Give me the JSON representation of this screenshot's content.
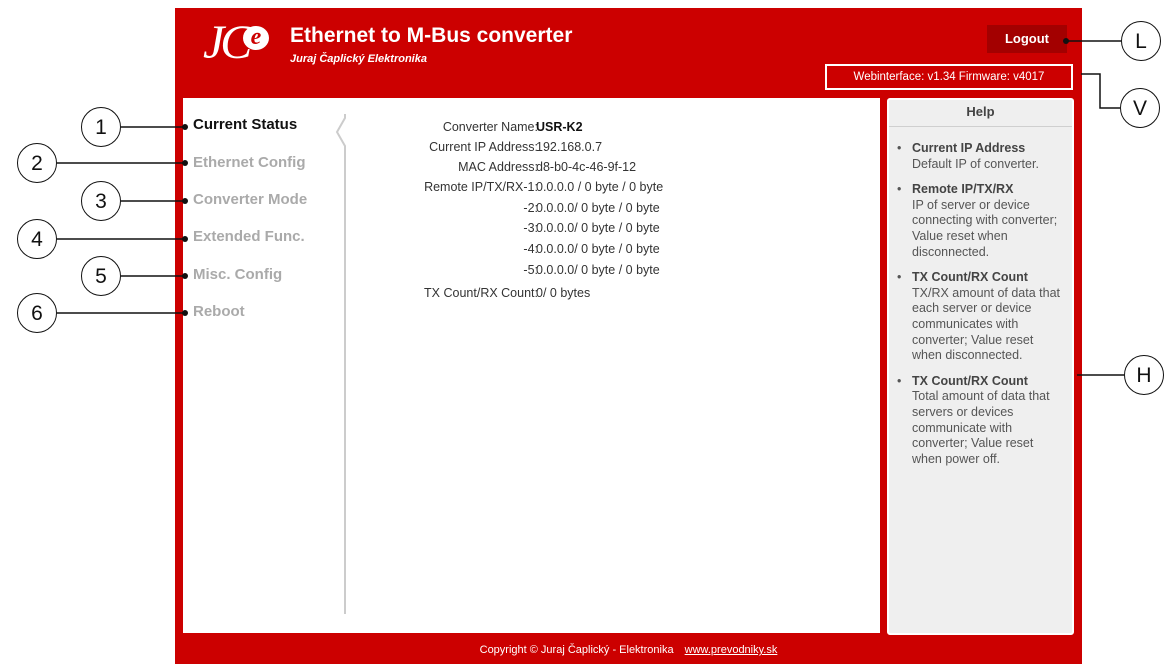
{
  "header": {
    "logo_text": "JC",
    "logo_badge": "e",
    "title": "Ethernet to M-Bus converter",
    "subtitle": "Juraj Čaplický Elektronika",
    "logout_label": "Logout",
    "version_text": "Webinterface: v1.34   Firmware: v4017"
  },
  "menu": {
    "items": [
      {
        "label": "Current Status",
        "active": true
      },
      {
        "label": "Ethernet Config",
        "active": false
      },
      {
        "label": "Converter Mode",
        "active": false
      },
      {
        "label": "Extended Func.",
        "active": false
      },
      {
        "label": "Misc. Config",
        "active": false
      },
      {
        "label": "Reboot",
        "active": false
      }
    ]
  },
  "status": {
    "rows": [
      {
        "label": "Converter Name:",
        "value": "USR-K2"
      },
      {
        "label": "Current IP Address:",
        "value": "192.168.0.7"
      },
      {
        "label": "MAC Address:",
        "value": "d8-b0-4c-46-9f-12"
      },
      {
        "label": "Remote IP/TX/RX-1:",
        "value": "0.0.0.0 / 0 byte / 0 byte"
      },
      {
        "label": "-2:",
        "value": "0.0.0.0/ 0 byte / 0 byte"
      },
      {
        "label": "-3:",
        "value": "0.0.0.0/ 0 byte / 0 byte"
      },
      {
        "label": "-4:",
        "value": "0.0.0.0/ 0 byte / 0 byte"
      },
      {
        "label": "-5:",
        "value": "0.0.0.0/ 0 byte / 0 byte"
      },
      {
        "label": "TX Count/RX Count:",
        "value": "0/ 0 bytes"
      }
    ]
  },
  "help": {
    "title": "Help",
    "items": [
      {
        "heading": "Current IP Address",
        "text": "Default IP of converter."
      },
      {
        "heading": "Remote IP/TX/RX",
        "text": "IP of server or device connecting with converter; Value reset when disconnected."
      },
      {
        "heading": "TX Count/RX Count",
        "text": "TX/RX amount of data that each server or device communicates with converter; Value reset when disconnected."
      },
      {
        "heading": "TX Count/RX Count",
        "text": "Total amount of data that servers or devices communicate with converter; Value reset when power off."
      }
    ]
  },
  "footer": {
    "copyright": "Copyright © Juraj Čaplický - Elektronika",
    "link": "www.prevodniky.sk"
  },
  "callouts": {
    "c1": "1",
    "c2": "2",
    "c3": "3",
    "c4": "4",
    "c5": "5",
    "c6": "6",
    "L": "L",
    "V": "V",
    "H": "H"
  },
  "colors": {
    "brand_red": "#cc0000",
    "logout_bg": "#a30000",
    "help_bg": "#efefef",
    "menu_inactive": "#aaaaaa"
  }
}
